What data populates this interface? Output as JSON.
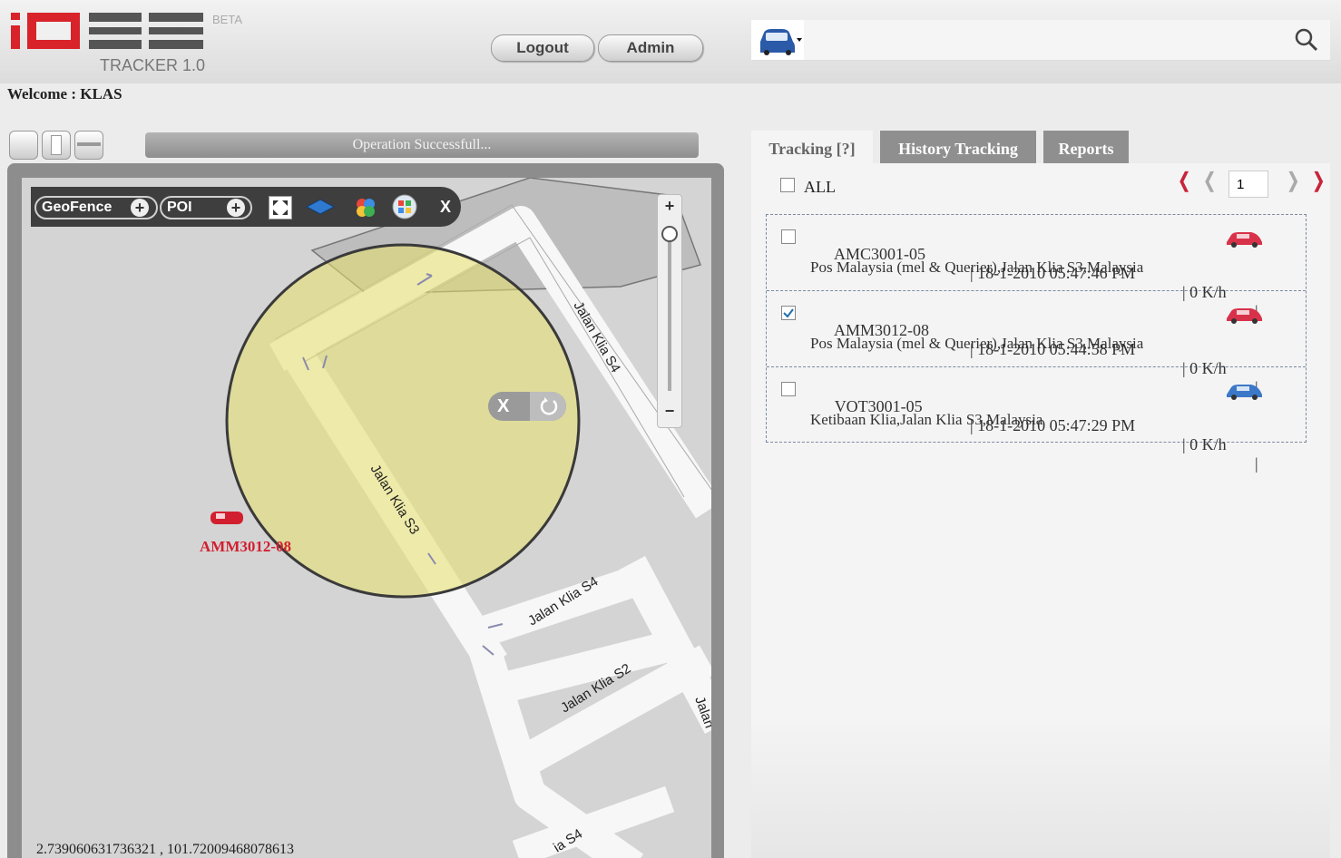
{
  "header": {
    "logo_text": "iDEE",
    "beta_label": "BETA",
    "subtitle": "TRACKER 1.0",
    "logout_label": "Logout",
    "admin_label": "Admin",
    "search_placeholder": "",
    "welcome": "Welcome : KLAS"
  },
  "status": {
    "message": "Operation Successfull..."
  },
  "map": {
    "toolbar": {
      "geofence_label": "GeoFence",
      "poi_label": "POI",
      "close_label": "X"
    },
    "roads": [
      "Jalan Klia S4",
      "Jalan Klia S3",
      "Jalan Klia S4",
      "Jalan Klia S2",
      "Jalan",
      "ia S4"
    ],
    "vehicle_marker_label": "AMM3012-08",
    "geofence_close": "X",
    "coordinates": "2.739060631736321 , 101.72009468078613",
    "zoom_in": "+",
    "zoom_out": "−"
  },
  "tabs": [
    {
      "label": "Tracking [?]"
    },
    {
      "label": "History Tracking"
    },
    {
      "label": "Reports"
    }
  ],
  "tracking": {
    "all_label": "ALL",
    "page": "1",
    "vehicles": [
      {
        "id": "AMC3001-05",
        "time": "| 18-1-2010 05:47:46 PM",
        "speed": "| 0 K/h",
        "sep": "|",
        "address": "Pos Malaysia (mel & Querier),Jalan Klia S3,Malaysia",
        "checked": false,
        "car_color": "#d8324a"
      },
      {
        "id": "AMM3012-08",
        "time": "| 18-1-2010 05:44:58 PM",
        "speed": "| 0 K/h",
        "sep": "|",
        "address": "Pos Malaysia (mel & Querier),Jalan Klia S3,Malaysia",
        "checked": true,
        "car_color": "#d8324a"
      },
      {
        "id": "VOT3001-05",
        "time": "| 18-1-2010 05:47:29 PM",
        "speed": "| 0 K/h",
        "sep": "|",
        "address": "Ketibaan Klia,Jalan Klia S3,Malaysia",
        "checked": false,
        "car_color": "#3c78c8"
      }
    ]
  },
  "colors": {
    "accent_red": "#d8232a",
    "pager_red": "#c8243a",
    "tab_active_bg": "#f4f4f4",
    "tab_inactive_bg": "#8f8f8f"
  },
  "icons": [
    "car-icon",
    "search-icon",
    "plus-icon",
    "fullscreen-icon",
    "layers-icon",
    "google-maps-icon",
    "windows-maps-icon",
    "close-icon",
    "refresh-icon"
  ]
}
